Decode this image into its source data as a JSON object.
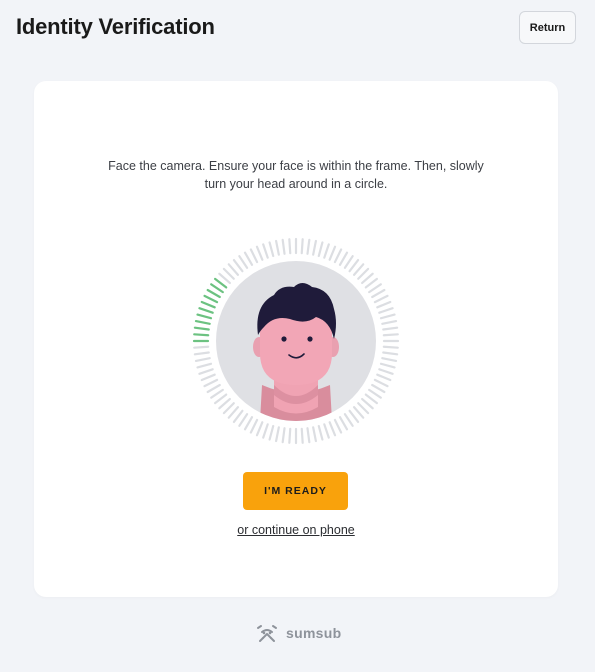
{
  "header": {
    "title": "Identity Verification",
    "return_label": "Return"
  },
  "card": {
    "instructions": "Face the camera. Ensure your face is within the frame. Then, slowly turn your head around in a circle.",
    "scan_progress": 0.11,
    "ready_label": "I'M READY",
    "phone_link": "or continue on phone"
  },
  "footer": {
    "brand": "sumsub",
    "brand_icon": "sumsub-logo-icon"
  },
  "colors": {
    "background": "#f2f4f8",
    "accent": "#f9a20c",
    "progress": "#6cc281",
    "tick": "#dcdee2",
    "face": "#f2a6b6",
    "hair": "#1f1b3a"
  }
}
